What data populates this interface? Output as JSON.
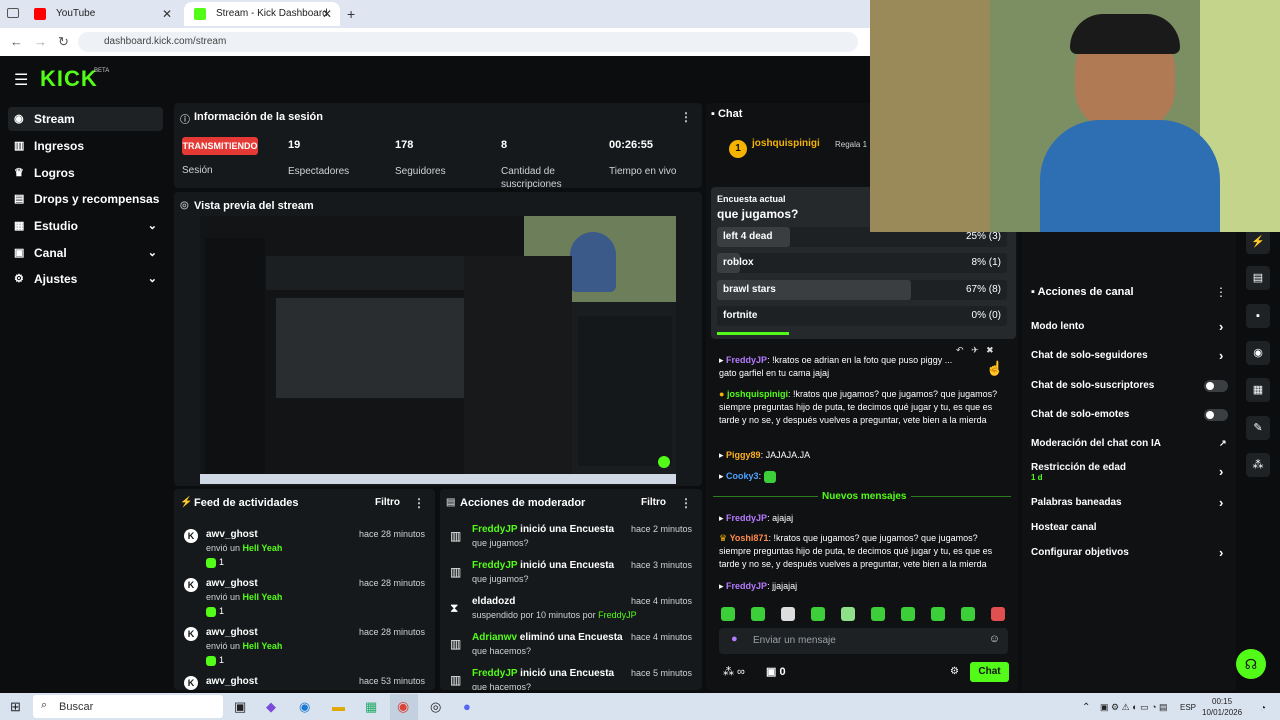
{
  "browser": {
    "tabs": [
      {
        "label": "YouTube"
      },
      {
        "label": "Stream - Kick Dashboard"
      }
    ],
    "new_tab": "+",
    "url": "dashboard.kick.com/stream"
  },
  "brand": {
    "logo": "KICK",
    "beta": "BETA",
    "accent": "#53fc18"
  },
  "sidebar": {
    "items": [
      {
        "label": "Stream",
        "icon": "broadcast-icon"
      },
      {
        "label": "Ingresos",
        "icon": "chart-icon"
      },
      {
        "label": "Logros",
        "icon": "trophy-icon"
      },
      {
        "label": "Drops y recompensas",
        "icon": "gift-icon"
      },
      {
        "label": "Estudio",
        "icon": "grid-icon"
      },
      {
        "label": "Canal",
        "icon": "tv-icon"
      },
      {
        "label": "Ajustes",
        "icon": "gear-icon"
      }
    ]
  },
  "session": {
    "title": "Información de la sesión",
    "status": "TRANSMITIENDO",
    "status_label": "Sesión",
    "stats": [
      {
        "value": "19",
        "label": "Espectadores"
      },
      {
        "value": "178",
        "label": "Seguidores"
      },
      {
        "value": "8",
        "label": "Cantidad de suscripciones"
      },
      {
        "value": "00:26:55",
        "label": "Tiempo en vivo"
      }
    ]
  },
  "preview": {
    "title": "Vista previa del stream"
  },
  "feed": {
    "title": "Feed de actividades",
    "filter": "Filtro",
    "rows": [
      {
        "name": "awv_ghost",
        "sub_pre": "envió un",
        "gift": "Hell Yeah",
        "count": "1",
        "time": "hace 28 minutos"
      },
      {
        "name": "awv_ghost",
        "sub_pre": "envió un",
        "gift": "Hell Yeah",
        "count": "1",
        "time": "hace 28 minutos"
      },
      {
        "name": "awv_ghost",
        "sub_pre": "envió un",
        "gift": "Hell Yeah",
        "count": "1",
        "time": "hace 28 minutos"
      },
      {
        "name": "awv_ghost",
        "sub_pre": "",
        "gift": "",
        "count": "",
        "time": "hace 53 minutos"
      }
    ]
  },
  "mod": {
    "title": "Acciones de moderador",
    "filter": "Filtro",
    "rows": [
      {
        "user": "FreddyJP",
        "action": "inició una Encuesta",
        "sub": "que jugamos?",
        "time": "hace 2 minutos"
      },
      {
        "user": "FreddyJP",
        "action": "inició una Encuesta",
        "sub": "que jugamos?",
        "time": "hace 3 minutos"
      },
      {
        "user": "eldadozd",
        "action": "",
        "sub": "suspendido por 10 minutos por",
        "sub_user": "FreddyJP",
        "time": "hace 4 minutos"
      },
      {
        "user": "Adrianwv",
        "action": "eliminó una Encuesta",
        "sub": "que hacemos?",
        "time": "hace 4 minutos"
      },
      {
        "user": "FreddyJP",
        "action": "inició una Encuesta",
        "sub": "que hacemos?",
        "time": "hace 5 minutos"
      }
    ]
  },
  "chat": {
    "title": "Chat",
    "pinned_user": "joshquispinigi",
    "pinned_count": "1",
    "pinned_right": "Regala 1 posición",
    "poll": {
      "label": "Encuesta actual",
      "question": "que jugamos?",
      "options": [
        {
          "label": "left 4 dead",
          "pct": "25% (3)",
          "frac": 0.25
        },
        {
          "label": "roblox",
          "pct": "8% (1)",
          "frac": 0.08
        },
        {
          "label": "brawl stars",
          "pct": "67% (8)",
          "frac": 0.67
        },
        {
          "label": "fortnite",
          "pct": "0% (0)",
          "frac": 0
        }
      ]
    },
    "messages": [
      {
        "user": "FreddyJP",
        "text": "!kratos oe adrian en la foto que puso piggy ... gato garfiel en tu cama jajaj",
        "color": "#b57bff"
      },
      {
        "user": "joshquispinigi",
        "text": "!kratos que jugamos? que jugamos? que jugamos? siempre preguntas hijo de puta, te decimos qué jugar y tu, es que es tarde y no se, y después vuelves a preguntar, vete bien a la mierda",
        "color": "#53fc18"
      },
      {
        "user": "Piggy89",
        "text": "JAJAJA.JA",
        "color": "#ffb020"
      },
      {
        "user": "Cooky3",
        "text": "",
        "color": "#4aa3ff"
      }
    ],
    "new_label": "Nuevos mensajes",
    "new_messages": [
      {
        "user": "FreddyJP",
        "text": "ajajaj",
        "color": "#b57bff"
      },
      {
        "user": "Yoshi871",
        "text": "!kratos que jugamos? que jugamos? que jugamos? siempre preguntas hijo de puta, te decimos qué jugar y tu, es que es tarde y no se, y después vuelves a preguntar, vete bien a la mierda",
        "color": "#ff8c4a"
      },
      {
        "user": "FreddyJP",
        "text": "jjajajaj",
        "color": "#b57bff"
      }
    ],
    "placeholder": "Enviar un mensaje",
    "points": "0",
    "send": "Chat"
  },
  "actions": {
    "title": "Acciones de canal",
    "items": [
      {
        "label": "Modo lento",
        "kind": "chevron"
      },
      {
        "label": "Chat de solo-seguidores",
        "kind": "chevron"
      },
      {
        "label": "Chat de solo-suscriptores",
        "kind": "toggle"
      },
      {
        "label": "Chat de solo-emotes",
        "kind": "toggle"
      },
      {
        "label": "Moderación del chat con IA",
        "kind": "link"
      },
      {
        "label": "Restricción de edad",
        "kind": "chevron",
        "sub": "1 d"
      },
      {
        "label": "Palabras baneadas",
        "kind": "chevron"
      },
      {
        "label": "Hostear canal",
        "kind": "none"
      },
      {
        "label": "Configurar objetivos",
        "kind": "chevron"
      }
    ]
  },
  "taskbar": {
    "search": "Buscar",
    "lang": "ESP",
    "time": "00:15",
    "date": "10/01/2026"
  }
}
